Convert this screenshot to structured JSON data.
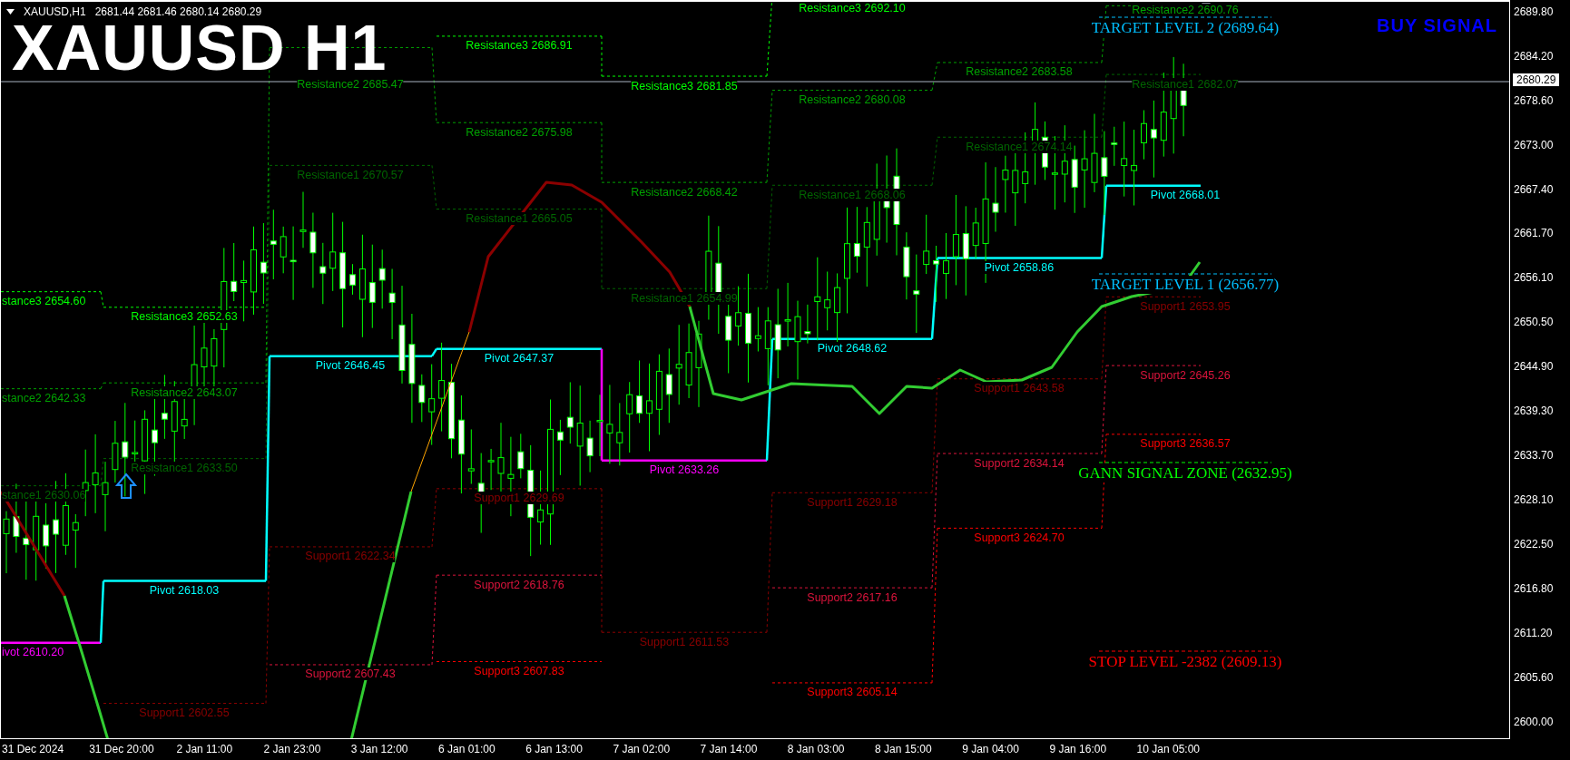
{
  "chart": {
    "symbol": "XAUUSD,H1",
    "quote": "2681.44 2681.46 2680.14 2680.29",
    "title": "XAUUSD H1",
    "signal": "BUY SIGNAL",
    "current_price": "2680.29"
  },
  "levels": [
    {
      "kind": "resistance",
      "text": "stance3 2654.60",
      "color": "#00ff00"
    },
    {
      "kind": "resistance",
      "text": "stance2 2642.33",
      "color": "#00a000"
    },
    {
      "kind": "resistance",
      "text": "stance1 2630.06",
      "color": "#006400"
    },
    {
      "kind": "pivot",
      "text": "ivot 2610.20",
      "color": "#ff00ff"
    },
    {
      "kind": "resistance",
      "text": "Resistance3 2652.63",
      "color": "#00ff00"
    },
    {
      "kind": "resistance",
      "text": "Resistance2 2643.07",
      "color": "#00a000"
    },
    {
      "kind": "resistance",
      "text": "Resistance1 2633.50",
      "color": "#006400"
    },
    {
      "kind": "pivot",
      "text": "Pivot 2618.03",
      "color": "#00ffff"
    },
    {
      "kind": "support",
      "text": "Support1 2602.55",
      "color": "#8b0000"
    },
    {
      "kind": "resistance",
      "text": "Resistance2 2685.47",
      "color": "#00a000"
    },
    {
      "kind": "resistance",
      "text": "Resistance1 2670.57",
      "color": "#006400"
    },
    {
      "kind": "pivot",
      "text": "Pivot 2646.45",
      "color": "#00ffff"
    },
    {
      "kind": "support",
      "text": "Support1 2622.34",
      "color": "#8b0000"
    },
    {
      "kind": "support",
      "text": "Support2 2607.43",
      "color": "#dc143c"
    },
    {
      "kind": "resistance",
      "text": "Resistance3 2686.91",
      "color": "#00ff00"
    },
    {
      "kind": "resistance",
      "text": "Resistance2 2675.98",
      "color": "#00a000"
    },
    {
      "kind": "resistance",
      "text": "Resistance1 2665.05",
      "color": "#006400"
    },
    {
      "kind": "pivot",
      "text": "Pivot 2647.37",
      "color": "#00ffff"
    },
    {
      "kind": "support",
      "text": "Support1 2629.69",
      "color": "#8b0000"
    },
    {
      "kind": "support",
      "text": "Support2 2618.76",
      "color": "#dc143c"
    },
    {
      "kind": "support",
      "text": "Support3 2607.83",
      "color": "#ff0000"
    },
    {
      "kind": "resistance",
      "text": "Resistance3 2681.85",
      "color": "#00ff00"
    },
    {
      "kind": "resistance",
      "text": "Resistance2 2668.42",
      "color": "#00a000"
    },
    {
      "kind": "resistance",
      "text": "Resistance1 2654.99",
      "color": "#006400"
    },
    {
      "kind": "pivot",
      "text": "Pivot 2633.26",
      "color": "#ff00ff"
    },
    {
      "kind": "support",
      "text": "Support1 2611.53",
      "color": "#8b0000"
    },
    {
      "kind": "resistance",
      "text": "Resistance3 2692.10",
      "color": "#00ff00"
    },
    {
      "kind": "resistance",
      "text": "Resistance2 2680.08",
      "color": "#00a000"
    },
    {
      "kind": "resistance",
      "text": "Resistance1 2668.06",
      "color": "#006400"
    },
    {
      "kind": "pivot",
      "text": "Pivot 2648.62",
      "color": "#00ffff"
    },
    {
      "kind": "support",
      "text": "Support1 2629.18",
      "color": "#8b0000"
    },
    {
      "kind": "support",
      "text": "Support2 2617.16",
      "color": "#dc143c"
    },
    {
      "kind": "support",
      "text": "Support3 2605.14",
      "color": "#ff0000"
    },
    {
      "kind": "resistance",
      "text": "Resistance2 2683.58",
      "color": "#00a000"
    },
    {
      "kind": "resistance",
      "text": "Resistance1 2674.14",
      "color": "#006400"
    },
    {
      "kind": "pivot",
      "text": "Pivot 2658.86",
      "color": "#00ffff"
    },
    {
      "kind": "support",
      "text": "Support1 2643.58",
      "color": "#8b0000"
    },
    {
      "kind": "support",
      "text": "Support2 2634.14",
      "color": "#dc143c"
    },
    {
      "kind": "support",
      "text": "Support3 2624.70",
      "color": "#ff0000"
    },
    {
      "kind": "resistance",
      "text": "Resistance2 2690.76",
      "color": "#00a000"
    },
    {
      "kind": "resistance",
      "text": "Resistance1 2682.07",
      "color": "#006400"
    },
    {
      "kind": "pivot",
      "text": "Pivot 2668.01",
      "color": "#00ffff"
    },
    {
      "kind": "support",
      "text": "Support1 2653.95",
      "color": "#8b0000"
    },
    {
      "kind": "support",
      "text": "Support2 2645.26",
      "color": "#dc143c"
    },
    {
      "kind": "support",
      "text": "Support3 2636.57",
      "color": "#ff0000"
    }
  ],
  "signals": [
    {
      "text": "TARGET LEVEL 2 (2689.64)",
      "color": "#00bfff"
    },
    {
      "text": "TARGET LEVEL 1 (2656.77)",
      "color": "#00bfff"
    },
    {
      "text": "GANN SIGNAL ZONE (2632.95)",
      "color": "#00ff00"
    },
    {
      "text": "STOP LEVEL -2382 (2609.13)",
      "color": "#ff0000"
    }
  ],
  "price_axis": [
    "2689.80",
    "2684.20",
    "2678.60",
    "2673.00",
    "2667.40",
    "2661.70",
    "2656.10",
    "2650.50",
    "2644.90",
    "2639.30",
    "2633.70",
    "2628.10",
    "2622.50",
    "2616.80",
    "2611.20",
    "2605.60",
    "2600.00"
  ],
  "time_axis": [
    "31 Dec 2024",
    "31 Dec 20:00",
    "2 Jan 11:00",
    "2 Jan 23:00",
    "3 Jan 12:00",
    "6 Jan 01:00",
    "6 Jan 13:00",
    "7 Jan 02:00",
    "7 Jan 14:00",
    "8 Jan 03:00",
    "8 Jan 15:00",
    "9 Jan 04:00",
    "9 Jan 16:00",
    "10 Jan 05:00"
  ]
}
